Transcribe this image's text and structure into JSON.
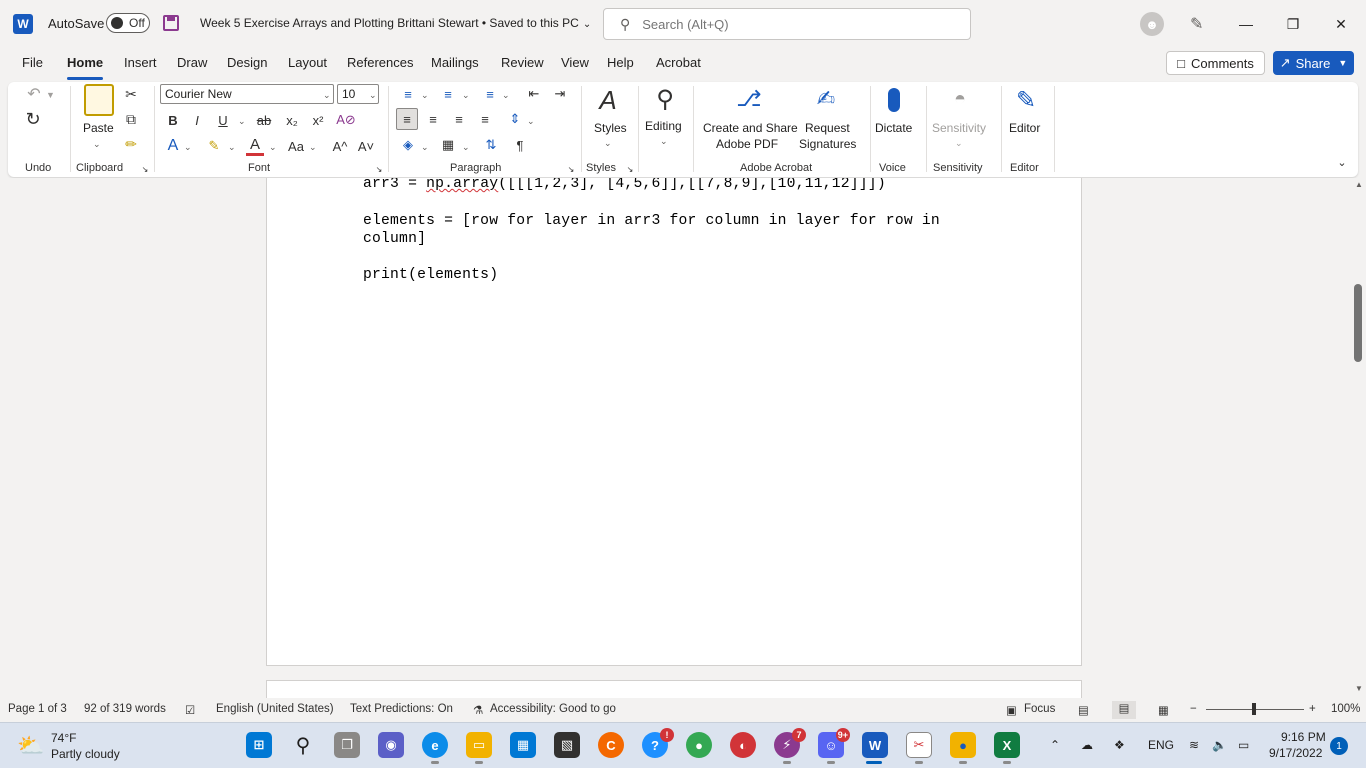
{
  "titlebar": {
    "app_logo": "W",
    "autosave_label": "AutoSave",
    "autosave_state": "Off",
    "doc_title": "Week 5 Exercise Arrays and Plotting Brittani Stewart • Saved to this PC",
    "search_placeholder": "Search (Alt+Q)",
    "icons": [
      "word-logo",
      "save-icon",
      "search-icon",
      "account-icon",
      "pen-icon",
      "minimize-icon",
      "restore-icon",
      "close-icon"
    ]
  },
  "menu": {
    "tabs": [
      "File",
      "Home",
      "Insert",
      "Draw",
      "Design",
      "Layout",
      "References",
      "Mailings",
      "Review",
      "View",
      "Help",
      "Acrobat"
    ],
    "active_tab": "Home",
    "comments_label": "Comments",
    "share_label": "Share"
  },
  "ribbon": {
    "groups": {
      "undo": "Undo",
      "clipboard": "Clipboard",
      "font": "Font",
      "paragraph": "Paragraph",
      "styles": "Styles",
      "adobe": "Adobe Acrobat",
      "voice": "Voice",
      "sensitivity": "Sensitivity",
      "editor": "Editor"
    },
    "paste_label": "Paste",
    "font_name": "Courier New",
    "font_size": "10",
    "bold": "B",
    "italic": "I",
    "underline": "U",
    "strike": "ab",
    "subscript": "x₂",
    "superscript": "x²",
    "change_case": "Aa",
    "grow_font": "A^",
    "shrink_font": "A˅",
    "styles_label": "Styles",
    "editing_label": "Editing",
    "create_share_label_1": "Create and Share",
    "create_share_label_2": "Adobe PDF",
    "request_sig_label_1": "Request",
    "request_sig_label_2": "Signatures",
    "dictate_label": "Dictate",
    "sensitivity_label": "Sensitivity",
    "editor_label": "Editor",
    "accent_color": "#185abd"
  },
  "document": {
    "line1_pre": "arr3 = ",
    "line1_mark": "np.array",
    "line1_post": "([[[1,2,3], [4,5,6]],[[7,8,9],[10,11,12]]])",
    "line2": "elements = [row for layer in arr3 for column in layer for row in",
    "line3": "column]",
    "line4": "print(elements)"
  },
  "status": {
    "page": "Page 1 of 3",
    "words": "92 of 319 words",
    "language": "English (United States)",
    "text_predictions": "Text Predictions: On",
    "accessibility": "Accessibility: Good to go",
    "focus": "Focus",
    "zoom_minus": "−",
    "zoom_plus": "+",
    "zoom": "100%"
  },
  "taskbar": {
    "temperature": "74°F",
    "condition": "Partly cloudy",
    "badge_discord": "9+",
    "badge_messenger": "7",
    "badge_help": "!",
    "language": "ENG",
    "time": "9:16 PM",
    "date": "9/17/2022",
    "notifications": "1"
  }
}
